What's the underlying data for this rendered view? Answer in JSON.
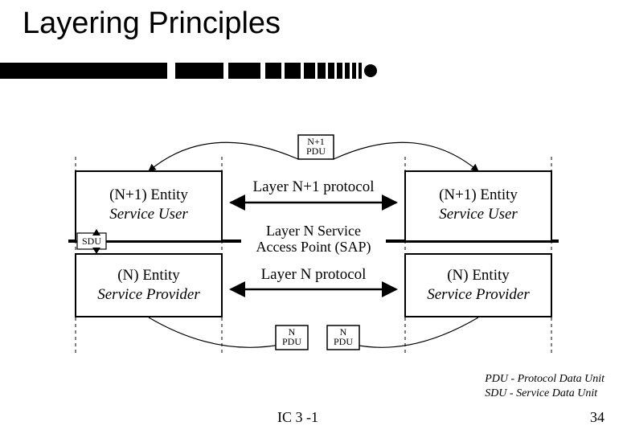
{
  "title": "Layering Principles",
  "diagram": {
    "n1pdu": "N+1\nPDU",
    "left_n1_line1": "(N+1) Entity",
    "left_n1_line2": "Service User",
    "right_n1_line1": "(N+1) Entity",
    "right_n1_line2": "Service User",
    "layer_n1_protocol": "Layer N+1 protocol",
    "sap_line1": "Layer N Service",
    "sap_line2": "Access Point (SAP)",
    "sdu": "SDU",
    "left_n_line1": "(N) Entity",
    "left_n_line2": "Service Provider",
    "right_n_line1": "(N) Entity",
    "right_n_line2": "Service Provider",
    "layer_n_protocol": "Layer N protocol",
    "npdu": "N\nPDU"
  },
  "legend": {
    "l1": "PDU - Protocol Data Unit",
    "l2": "SDU - Service Data Unit"
  },
  "footer": {
    "code": "IC 3 -1",
    "page": "34"
  }
}
